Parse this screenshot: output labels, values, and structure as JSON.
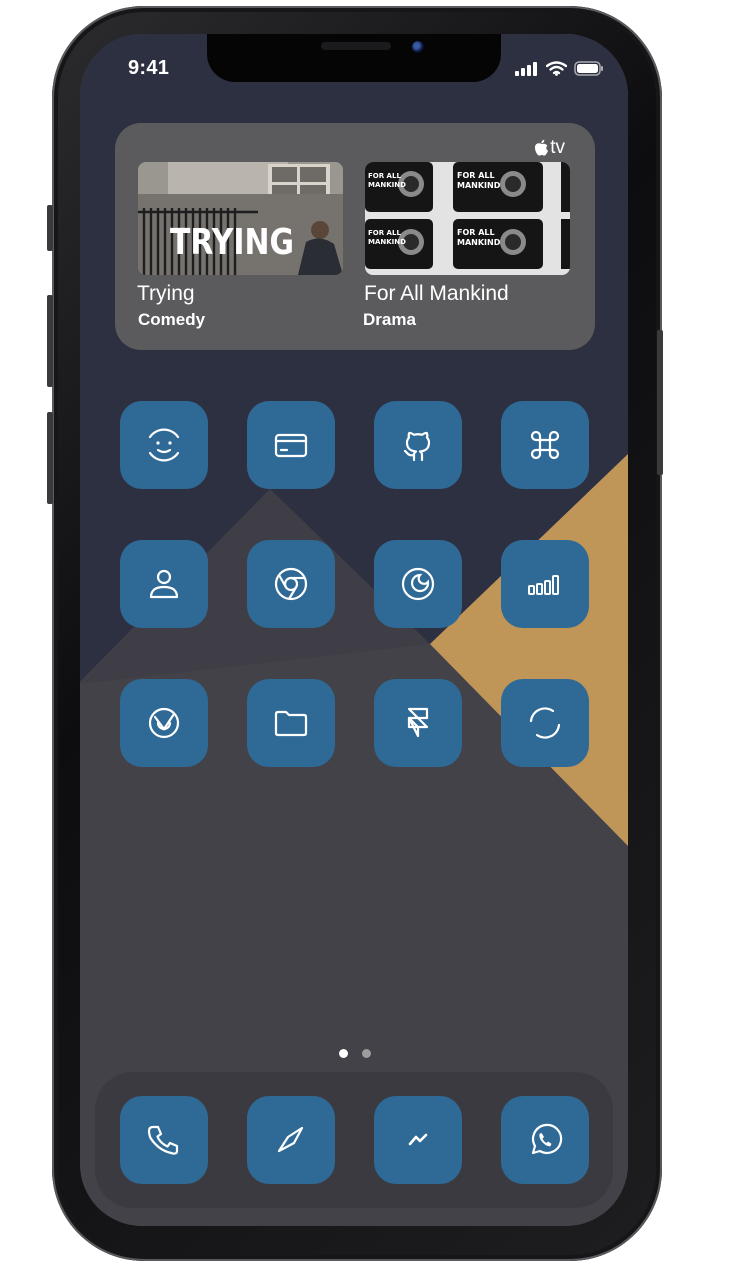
{
  "status_bar": {
    "time": "9:41"
  },
  "widget": {
    "provider": "tv",
    "shows": [
      {
        "title": "Trying",
        "genre": "Comedy",
        "poster_text": "TRYING"
      },
      {
        "title": "For All Mankind",
        "genre": "Drama",
        "poster_text": "FOR ALL MANKIND"
      }
    ]
  },
  "home_grid": [
    {
      "icon": "smiley-face-icon"
    },
    {
      "icon": "credit-card-icon"
    },
    {
      "icon": "github-icon"
    },
    {
      "icon": "command-key-icon"
    },
    {
      "icon": "contact-person-icon"
    },
    {
      "icon": "chrome-icon"
    },
    {
      "icon": "crunchyroll-icon"
    },
    {
      "icon": "bar-chart-icon"
    },
    {
      "icon": "onion-logo-icon"
    },
    {
      "icon": "folder-icon"
    },
    {
      "icon": "framer-icon"
    },
    {
      "icon": "circle-loader-icon"
    }
  ],
  "page_indicator": {
    "pages": 2,
    "current": 1
  },
  "dock": [
    {
      "icon": "phone-icon"
    },
    {
      "icon": "compass-needle-icon"
    },
    {
      "icon": "messenger-icon"
    },
    {
      "icon": "whatsapp-icon"
    }
  ],
  "colors": {
    "app_tile": "#2f6a97",
    "wallpaper_dark": "#2d3040",
    "wallpaper_mid": "#434249",
    "wallpaper_gold": "#c09658",
    "widget_bg": "#5b5b5d"
  }
}
